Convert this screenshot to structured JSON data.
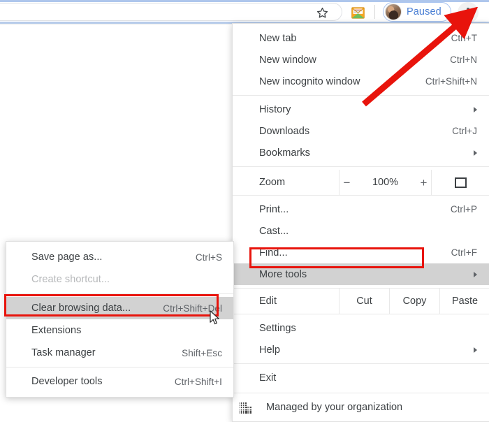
{
  "toolbar": {
    "star_icon": "star-bookmark-icon",
    "extension_icon": "mail-extension-icon",
    "profile_label": "Paused",
    "avatar": "user-avatar",
    "kebab_icon": "three-dot-menu-icon"
  },
  "main_menu": {
    "groups": [
      {
        "items": [
          {
            "label": "New tab",
            "accel": "Ctrl+T",
            "submenu": false
          },
          {
            "label": "New window",
            "accel": "Ctrl+N",
            "submenu": false
          },
          {
            "label": "New incognito window",
            "accel": "Ctrl+Shift+N",
            "submenu": false
          }
        ]
      },
      {
        "items": [
          {
            "label": "History",
            "accel": "",
            "submenu": true
          },
          {
            "label": "Downloads",
            "accel": "Ctrl+J",
            "submenu": false
          },
          {
            "label": "Bookmarks",
            "accel": "",
            "submenu": true
          }
        ]
      }
    ],
    "zoom_row": {
      "label": "Zoom",
      "minus": "−",
      "value": "100%",
      "plus": "+",
      "fullscreen_icon": "fullscreen-icon"
    },
    "group3": [
      {
        "label": "Print...",
        "accel": "Ctrl+P",
        "submenu": false
      },
      {
        "label": "Cast...",
        "accel": "",
        "submenu": false
      },
      {
        "label": "Find...",
        "accel": "Ctrl+F",
        "submenu": false
      },
      {
        "label": "More tools",
        "accel": "",
        "submenu": true,
        "highlighted": true
      }
    ],
    "edit_row": {
      "label": "Edit",
      "cut": "Cut",
      "copy": "Copy",
      "paste": "Paste"
    },
    "group4": [
      {
        "label": "Settings",
        "accel": "",
        "submenu": false
      },
      {
        "label": "Help",
        "accel": "",
        "submenu": true
      }
    ],
    "group5": [
      {
        "label": "Exit",
        "accel": "",
        "submenu": false
      }
    ],
    "managed": {
      "label": "Managed by your organization",
      "icon": "organization-building-icon"
    }
  },
  "sub_menu": {
    "group1": [
      {
        "label": "Save page as...",
        "accel": "Ctrl+S",
        "disabled": false
      },
      {
        "label": "Create shortcut...",
        "accel": "",
        "disabled": true
      }
    ],
    "group2": [
      {
        "label": "Clear browsing data...",
        "accel": "Ctrl+Shift+Del",
        "disabled": false,
        "highlighted": true
      },
      {
        "label": "Extensions",
        "accel": "",
        "disabled": false
      },
      {
        "label": "Task manager",
        "accel": "Shift+Esc",
        "disabled": false
      }
    ],
    "group3": [
      {
        "label": "Developer tools",
        "accel": "Ctrl+Shift+I",
        "disabled": false
      }
    ]
  },
  "annotations": {
    "highlight_color": "#e8140c",
    "arrow": "red-pointer-arrow",
    "cursor": "mouse-cursor"
  }
}
